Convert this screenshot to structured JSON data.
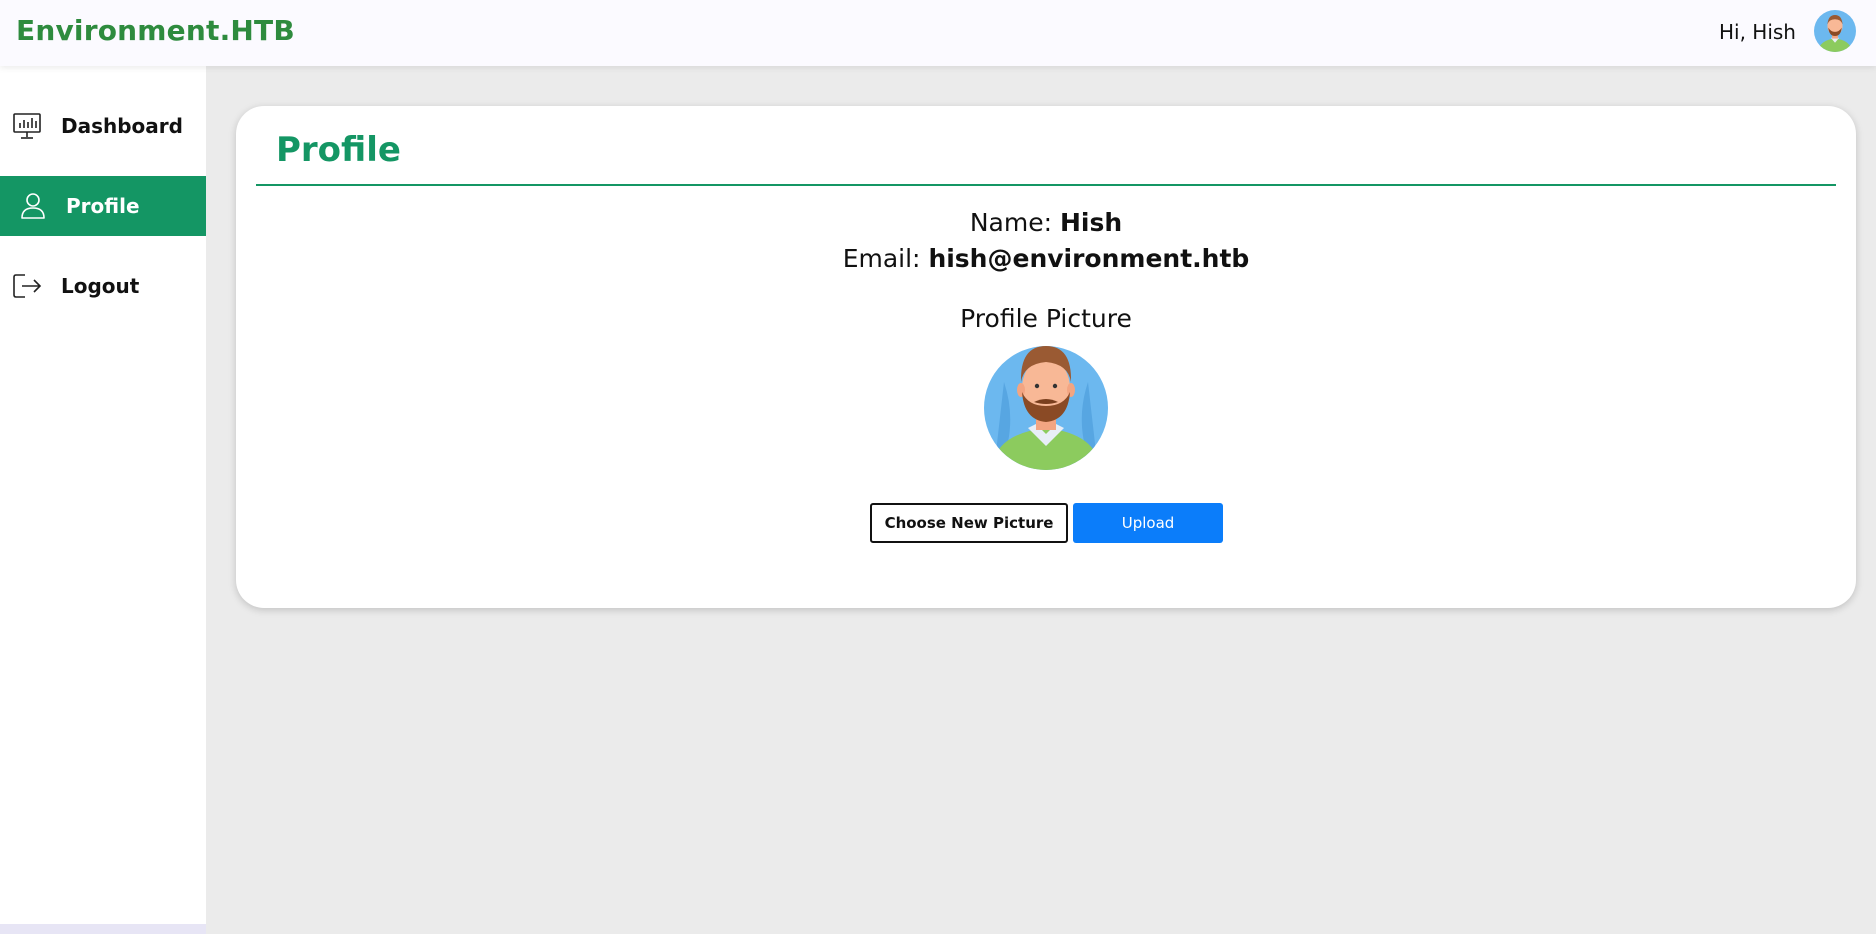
{
  "header": {
    "brand": "Environment.HTB",
    "greeting": "Hi, Hish",
    "avatar_icon": "user-avatar-icon"
  },
  "sidebar": {
    "items": [
      {
        "label": "Dashboard",
        "icon": "dashboard-chart-icon",
        "active": false
      },
      {
        "label": "Profile",
        "icon": "user-icon",
        "active": true
      },
      {
        "label": "Logout",
        "icon": "logout-icon",
        "active": false
      }
    ]
  },
  "profile": {
    "title": "Profile",
    "name_label": "Name:",
    "name_value": "Hish",
    "email_label": "Email:",
    "email_value": "hish@environment.htb",
    "picture_title": "Profile Picture",
    "choose_button": "Choose New Picture",
    "upload_button": "Upload"
  },
  "colors": {
    "brand_green": "#2e8b3e",
    "accent_green": "#149664",
    "upload_blue": "#0b7dfa",
    "background": "#ebebeb"
  }
}
